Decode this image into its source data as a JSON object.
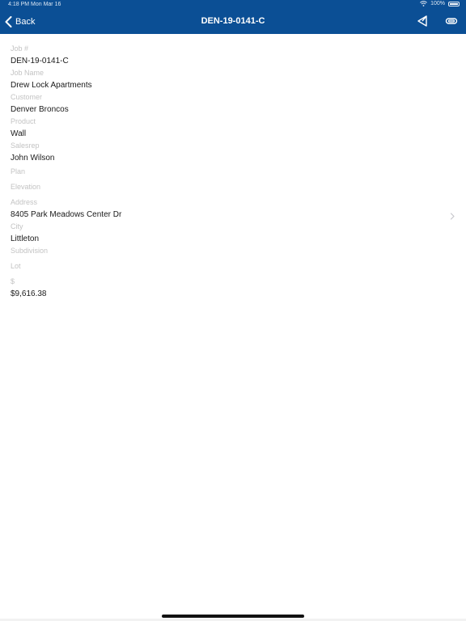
{
  "status_bar": {
    "time": "4:18 PM   Mon Mar 16",
    "battery": "100%"
  },
  "nav": {
    "back_label": "Back",
    "title": "DEN-19-0141-C"
  },
  "fields": [
    {
      "label": "Job #",
      "value": "DEN-19-0141-C"
    },
    {
      "label": "Job Name",
      "value": "Drew Lock Apartments"
    },
    {
      "label": "Customer",
      "value": "Denver Broncos"
    },
    {
      "label": "Product",
      "value": "Wall"
    },
    {
      "label": "Salesrep",
      "value": "John Wilson"
    },
    {
      "label": "Plan",
      "value": ""
    },
    {
      "label": "Elevation",
      "value": ""
    },
    {
      "label": "Address",
      "value": "8405 Park Meadows Center Dr"
    },
    {
      "label": "City",
      "value": "Littleton"
    },
    {
      "label": "Subdivision",
      "value": ""
    },
    {
      "label": "Lot",
      "value": ""
    },
    {
      "label": "$",
      "value": "$9,616.38"
    }
  ],
  "colors": {
    "header_bg": "#0b4f95",
    "label_color": "#c3c3c3",
    "value_color": "#1a1a1a"
  }
}
